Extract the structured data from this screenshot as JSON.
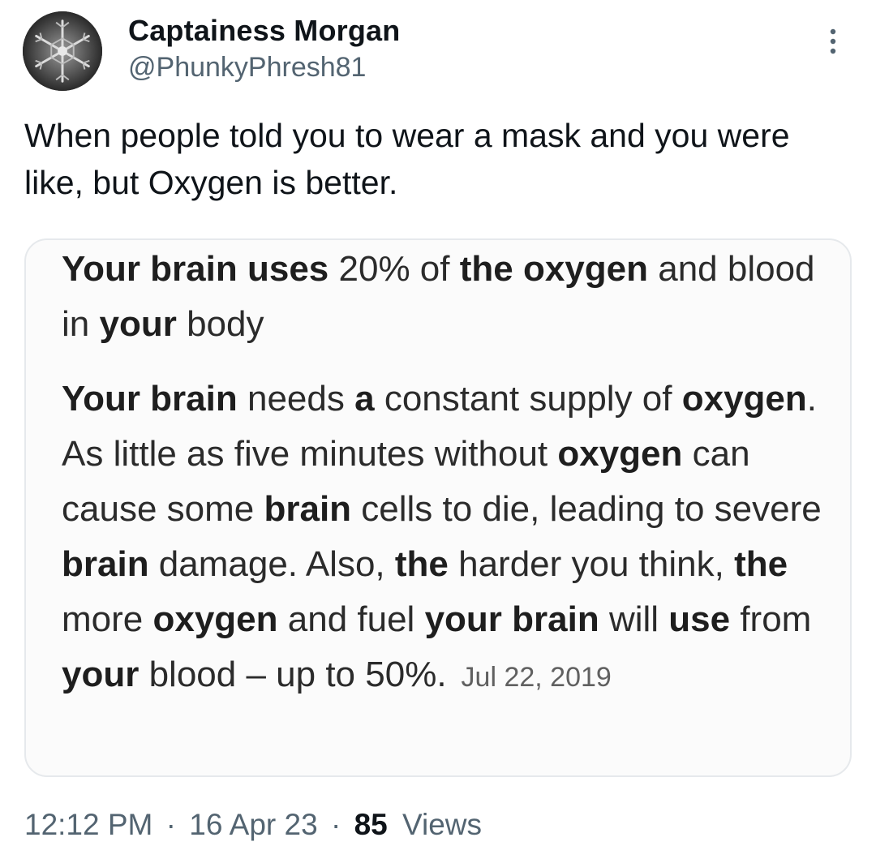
{
  "author": {
    "display_name": "Captainess Morgan",
    "handle": "@PhunkyPhresh81",
    "avatar_icon": "snowflake-avatar-icon"
  },
  "tweet": {
    "text": "When people told you to wear a mask and you were like, but Oxygen is better."
  },
  "media": {
    "paragraph1": [
      {
        "t": "Your brain uses",
        "b": true
      },
      {
        "t": " 20% of ",
        "b": false
      },
      {
        "t": "the oxygen",
        "b": true
      },
      {
        "t": " and blood in ",
        "b": false
      },
      {
        "t": "your",
        "b": true
      },
      {
        "t": " body",
        "b": false
      }
    ],
    "paragraph2": [
      {
        "t": "Your brain",
        "b": true
      },
      {
        "t": " needs ",
        "b": false
      },
      {
        "t": "a",
        "b": true
      },
      {
        "t": " constant supply of ",
        "b": false
      },
      {
        "t": "oxygen",
        "b": true
      },
      {
        "t": ". As little as five minutes without ",
        "b": false
      },
      {
        "t": "oxygen",
        "b": true
      },
      {
        "t": " can cause some ",
        "b": false
      },
      {
        "t": "brain",
        "b": true
      },
      {
        "t": " cells to die, leading to severe ",
        "b": false
      },
      {
        "t": "brain",
        "b": true
      },
      {
        "t": " damage. Also, ",
        "b": false
      },
      {
        "t": "the",
        "b": true
      },
      {
        "t": " harder you think, ",
        "b": false
      },
      {
        "t": "the",
        "b": true
      },
      {
        "t": " more ",
        "b": false
      },
      {
        "t": "oxygen",
        "b": true
      },
      {
        "t": " and fuel ",
        "b": false
      },
      {
        "t": "your brain",
        "b": true
      },
      {
        "t": " will ",
        "b": false
      },
      {
        "t": "use",
        "b": true
      },
      {
        "t": " from ",
        "b": false
      },
      {
        "t": "your",
        "b": true
      },
      {
        "t": " blood – up to 50%.",
        "b": false
      }
    ],
    "date": "Jul 22, 2019"
  },
  "meta": {
    "time": "12:12 PM",
    "separator": "·",
    "date": "16 Apr 23",
    "views_count": "85",
    "views_label": "Views"
  },
  "colors": {
    "text_primary": "#0f1419",
    "text_secondary": "#536471",
    "card_border": "#e6e9ec"
  },
  "icons": {
    "more": "more-vertical-icon"
  }
}
